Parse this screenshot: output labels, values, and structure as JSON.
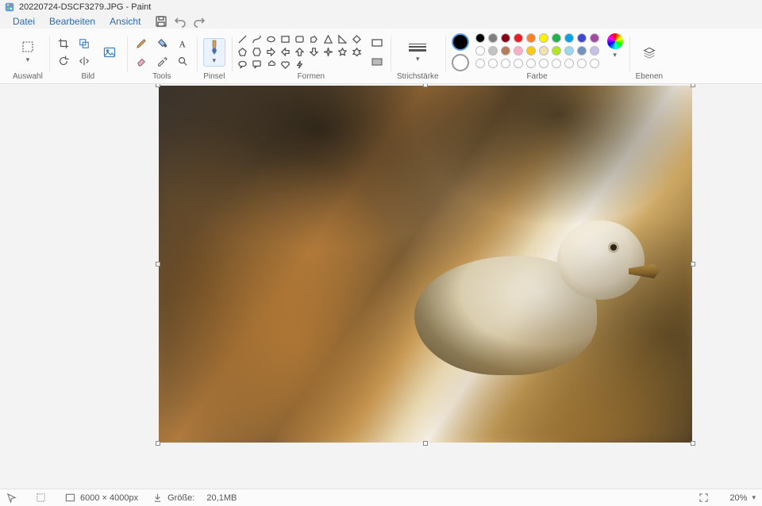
{
  "title": "20220724-DSCF3279.JPG - Paint",
  "menu": {
    "file": "Datei",
    "edit": "Bearbeiten",
    "view": "Ansicht"
  },
  "ribbon": {
    "selection": "Auswahl",
    "image": "Bild",
    "tools": "Tools",
    "brushes": "Pinsel",
    "shapes": "Formen",
    "stroke": "Strichstärke",
    "color": "Farbe",
    "layers": "Ebenen"
  },
  "colors_row1": [
    "#000000",
    "#7f7f7f",
    "#880015",
    "#ed1c24",
    "#ff7f27",
    "#fff200",
    "#22b14c",
    "#00a2e8",
    "#3f48cc",
    "#a349a4"
  ],
  "colors_row2": [
    "#ffffff",
    "#c3c3c3",
    "#b97a57",
    "#ffaec9",
    "#ffc90e",
    "#efe4b0",
    "#b5e61d",
    "#99d9ea",
    "#7092be",
    "#c8bfe7"
  ],
  "colors_row3": [
    "#ffffff",
    "#ffffff",
    "#ffffff",
    "#ffffff",
    "#ffffff",
    "#ffffff",
    "#ffffff",
    "#ffffff",
    "#ffffff",
    "#ffffff"
  ],
  "status": {
    "dimensions": "6000 × 4000px",
    "size_label": "Größe:",
    "size_value": "20,1MB",
    "zoom": "20%"
  }
}
